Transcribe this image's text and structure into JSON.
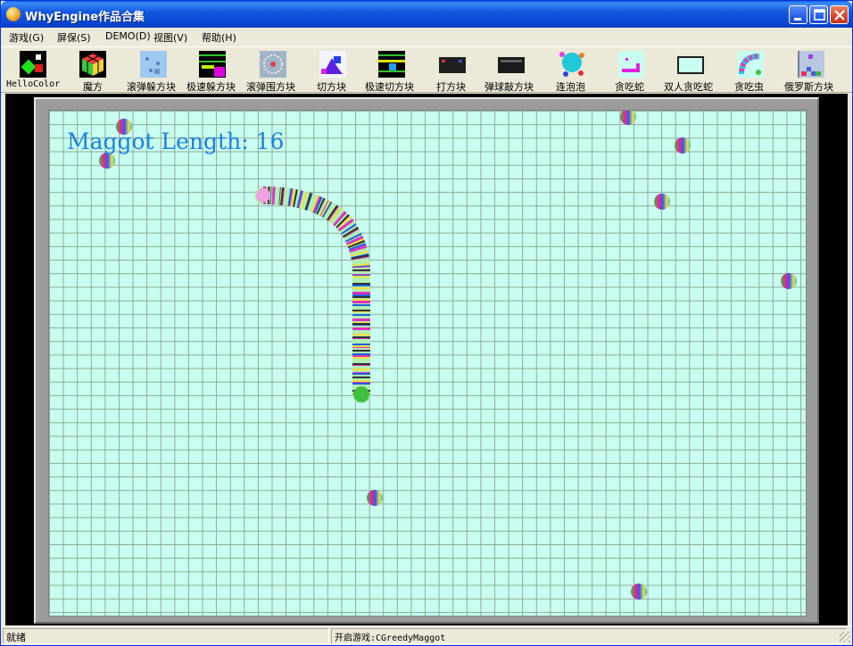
{
  "window": {
    "title": "WhyEngine作品合集",
    "icons": {
      "app": "app-icon",
      "minimize": "minimize-icon",
      "maximize": "maximize-icon",
      "close": "close-icon"
    }
  },
  "menu": {
    "items": [
      {
        "label": "游戏(G)"
      },
      {
        "label": "屏保(S)"
      },
      {
        "label": "DEMO(D)"
      },
      {
        "label": "视图(V)"
      },
      {
        "label": "帮助(H)"
      }
    ]
  },
  "toolbar": {
    "tools": [
      {
        "label": "HelloColor"
      },
      {
        "label": "魔方"
      },
      {
        "label": "滚弹躲方块"
      },
      {
        "label": "极速躲方块"
      },
      {
        "label": "滚弹围方块"
      },
      {
        "label": "切方块"
      },
      {
        "label": "极速切方块"
      },
      {
        "label": "打方块"
      },
      {
        "label": "弹球敲方块"
      },
      {
        "label": "连泡泡"
      },
      {
        "label": "贪吃蛇"
      },
      {
        "label": "双人贪吃蛇"
      },
      {
        "label": "贪吃虫"
      },
      {
        "label": "俄罗斯方块"
      }
    ]
  },
  "game": {
    "score_text": "Maggot Length: 16",
    "colors": {
      "board": "#C8FFF0",
      "grid": "#8EA898",
      "score": "#1D80DC",
      "frame": "#9C9C9C"
    }
  },
  "status": {
    "left": "就绪",
    "right": "开启游戏:CGreedyMaggot"
  }
}
